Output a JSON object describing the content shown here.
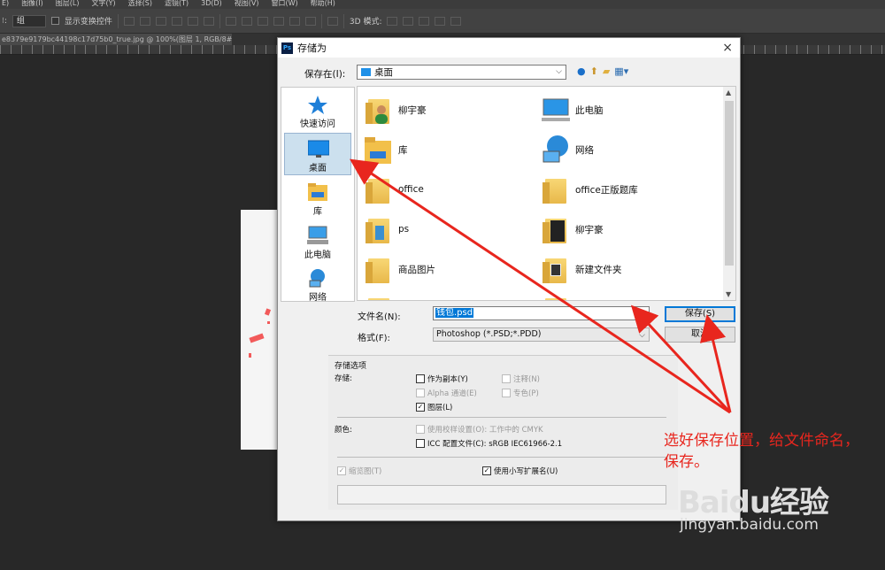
{
  "ps": {
    "menu": [
      "E)",
      "图像(I)",
      "图层(L)",
      "文字(Y)",
      "选择(S)",
      "滤镜(T)",
      "3D(D)",
      "视图(V)",
      "窗口(W)",
      "帮助(H)"
    ],
    "option_select": "组",
    "show_transform": "显示变换控件",
    "mode_3d": "3D 模式:",
    "doc_tab": "e8379e9179bc44198c17d75b0_true.jpg @ 100%(图层 1, RGB/8#) *  ×"
  },
  "dialog": {
    "title": "存储为",
    "close": "×",
    "save_in_label": "保存在(I):",
    "save_in_value": "桌面",
    "places": [
      "快速访问",
      "桌面",
      "库",
      "此电脑",
      "网络"
    ],
    "files": [
      "柳宇豪",
      "此电脑",
      "库",
      "网络",
      "office",
      "office正版题库",
      "ps",
      "柳宇豪",
      "商品图片",
      "新建文件夹"
    ],
    "filename_label": "文件名(N):",
    "filename_value": "钱包.psd",
    "format_label": "格式(F):",
    "format_value": "Photoshop (*.PSD;*.PDD)",
    "save_button": "保存(S)",
    "cancel_button": "取消",
    "options": {
      "header": "存储选项",
      "store_label": "存储:",
      "as_copy": "作为副本(Y)",
      "notes": "注释(N)",
      "alpha": "Alpha 通道(E)",
      "spot": "专色(P)",
      "layers": "图层(L)",
      "color_label": "颜色:",
      "proof": "使用校样设置(O): 工作中的 CMYK",
      "icc": "ICC 配置文件(C): sRGB IEC61966-2.1",
      "thumbnail": "缩览图(T)",
      "lowercase": "使用小写扩展名(U)"
    }
  },
  "annotation": {
    "callout": "选好保存位置，给文件命名，保存。",
    "color": "#e8261e"
  },
  "watermark": {
    "brand": "Baidu经验",
    "url": "jingyan.baidu.com"
  }
}
